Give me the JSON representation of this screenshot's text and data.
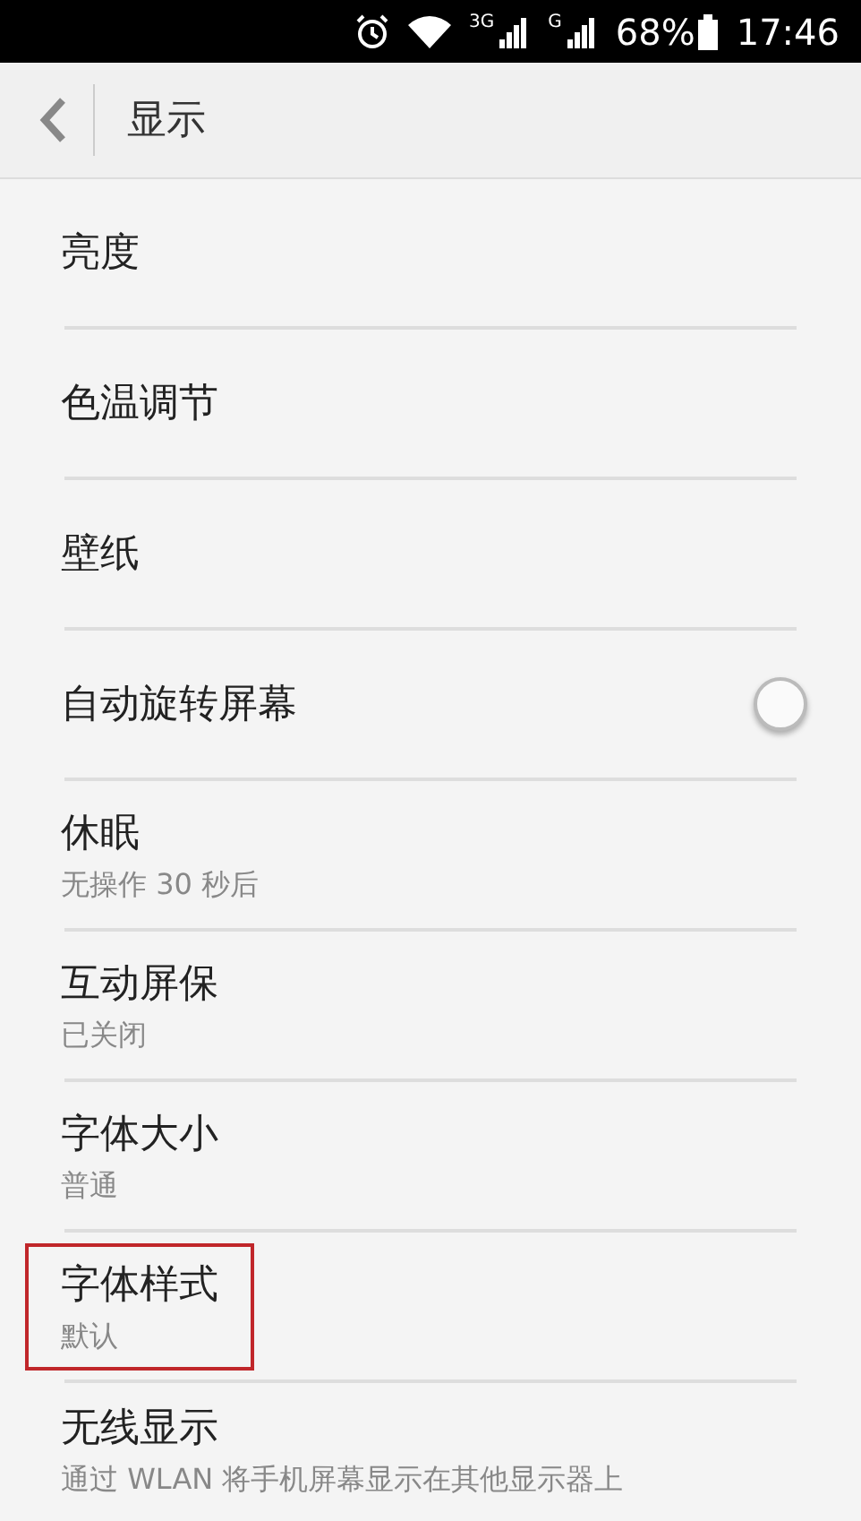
{
  "status_bar": {
    "battery": "68%",
    "time": "17:46",
    "network_1": "3G",
    "network_2": "G"
  },
  "header": {
    "title": "显示"
  },
  "items": [
    {
      "kind": "plain",
      "title": "亮度"
    },
    {
      "kind": "plain",
      "title": "色温调节"
    },
    {
      "kind": "plain",
      "title": "壁纸"
    },
    {
      "kind": "toggle",
      "title": "自动旋转屏幕",
      "on": false
    },
    {
      "kind": "plain",
      "title": "休眠",
      "subtitle": "无操作 30 秒后"
    },
    {
      "kind": "plain",
      "title": "互动屏保",
      "subtitle": "已关闭"
    },
    {
      "kind": "plain",
      "title": "字体大小",
      "subtitle": "普通"
    },
    {
      "kind": "plain",
      "title": "字体样式",
      "subtitle": "默认",
      "highlighted": true
    },
    {
      "kind": "plain",
      "title": "无线显示",
      "subtitle": "通过 WLAN 将手机屏幕显示在其他显示器上"
    }
  ]
}
